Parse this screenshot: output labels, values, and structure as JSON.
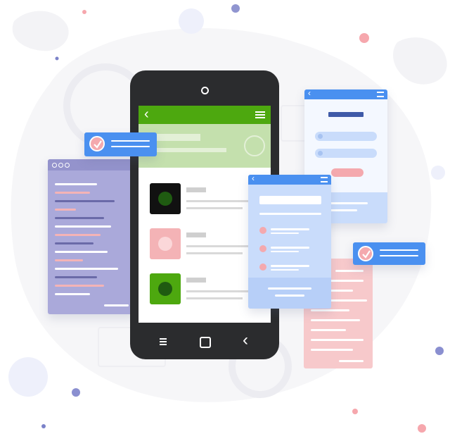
{
  "illustration": {
    "type": "mobile-app-development-illustration",
    "text_content": "none"
  },
  "colors": {
    "app_green": "#4da80f",
    "app_green_light": "#c4e0ad",
    "phone_frame": "#2b2c2e",
    "accent_blue": "#4a90f0",
    "panel_blue_light": "#c9dcfb",
    "code_panel_purple": "#aaa9da",
    "pink": "#f4b3b6",
    "pink_button": "#f4a9ae",
    "dot_purple": "#7b82c9",
    "dot_pink": "#f6a7ad"
  },
  "icons": {
    "phone_nav": [
      "menu-icon",
      "home-square-icon",
      "back-chevron-icon"
    ],
    "app_header": [
      "back-chevron-icon",
      "hamburger-menu-icon"
    ],
    "badges": [
      "checkmark-icon",
      "checkmark-icon"
    ]
  }
}
